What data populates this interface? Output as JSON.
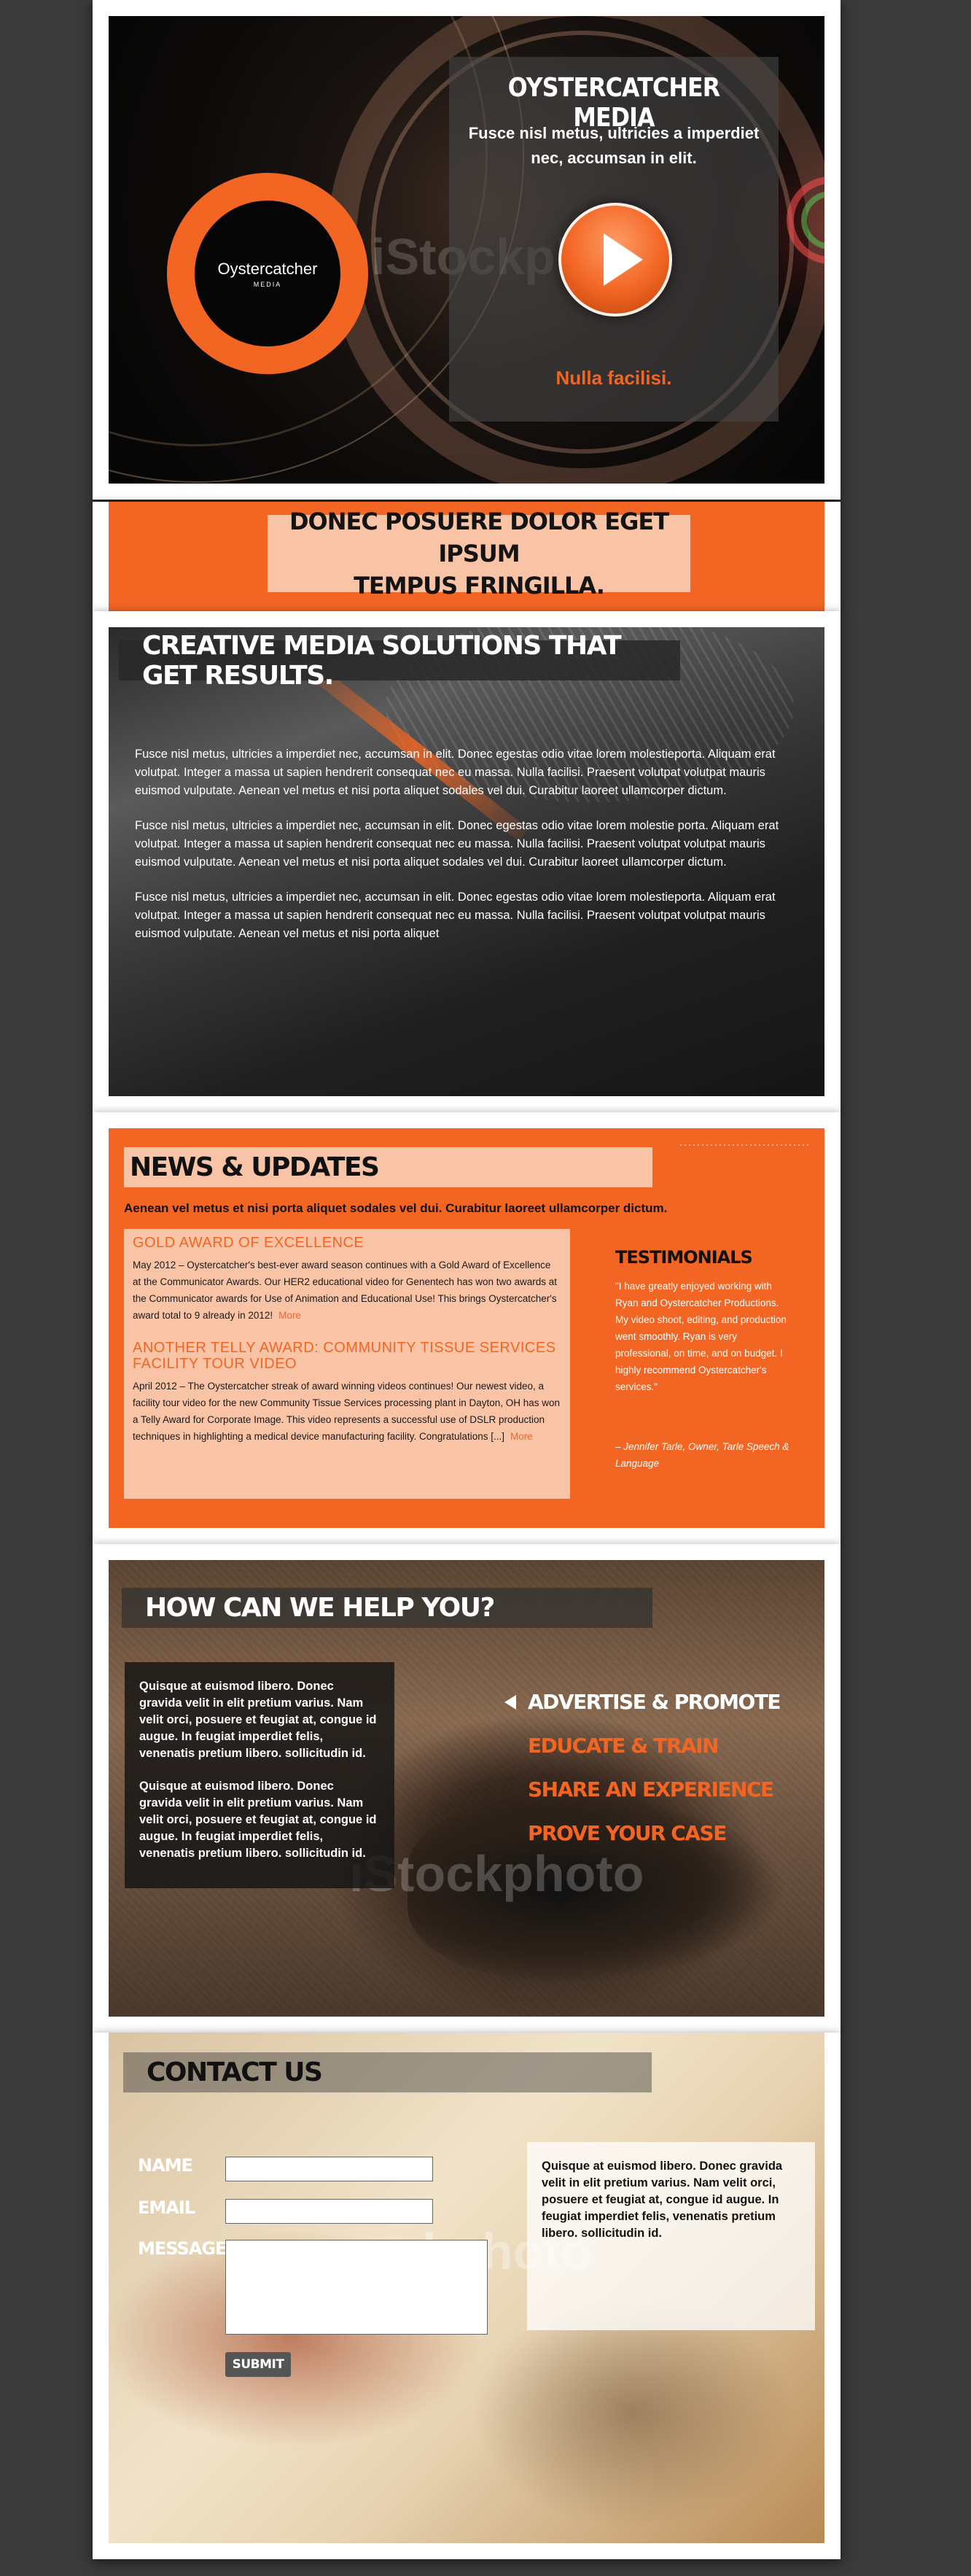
{
  "hero": {
    "logo_name": "Oystercatcher",
    "logo_sub": "MEDIA",
    "watermark": "iStockphoto",
    "title": "OYSTERCATCHER MEDIA",
    "subtitle_line1": "Fusce nisl metus, ultricies a imperdiet",
    "subtitle_line2": "nec, accumsan in elit.",
    "cta": "Nulla facilisi.",
    "accent_color": "#f26522"
  },
  "banner": {
    "line1": "DONEC POSUERE DOLOR EGET IPSUM",
    "line2": "TEMPUS FRINGILLA."
  },
  "creative": {
    "heading": "CREATIVE MEDIA SOLUTIONS THAT GET RESULTS.",
    "paragraphs": [
      "Fusce nisl metus, ultricies a imperdiet nec, accumsan in elit. Donec egestas odio vitae lorem molestieporta. Aliquam erat volutpat. Integer a massa ut sapien hendrerit consequat nec eu massa. Nulla facilisi. Praesent volutpat volutpat mauris euismod vulputate. Aenean vel metus et nisi porta aliquet sodales vel dui. Curabitur laoreet ullamcorper dictum.",
      "Fusce nisl metus, ultricies a imperdiet nec, accumsan in elit. Donec egestas odio vitae lorem molestie porta. Aliquam erat volutpat. Integer a massa ut sapien hendrerit consequat nec eu massa. Nulla facilisi. Praesent volutpat volutpat mauris euismod vulputate. Aenean vel metus et nisi porta aliquet sodales vel dui. Curabitur laoreet ullamcorper dictum.",
      "Fusce nisl metus, ultricies a imperdiet nec, accumsan in elit. Donec egestas odio vitae lorem molestieporta. Aliquam erat volutpat. Integer a massa ut sapien hendrerit consequat nec eu massa. Nulla facilisi. Praesent volutpat volutpat mauris euismod vulputate. Aenean vel metus et nisi porta aliquet"
    ]
  },
  "news": {
    "heading": "NEWS & UPDATES",
    "intro": "Aenean vel metus et nisi porta aliquet sodales vel dui. Curabitur laoreet ullamcorper dictum.",
    "items": [
      {
        "title": "GOLD AWARD OF EXCELLENCE",
        "body": "May 2012 – Oystercatcher's best-ever award season continues with a Gold Award of Excellence at the Communicator Awards.  Our HER2 educational video for Genentech has won two awards at the Communicator awards for Use of Animation and Educational Use!  This brings Oystercatcher's award total to 9 already in 2012!",
        "more": "More"
      },
      {
        "title": "ANOTHER TELLY AWARD: COMMUNITY TISSUE SERVICES FACILITY TOUR VIDEO",
        "body": "April 2012 – The Oystercatcher streak of award winning videos continues!  Our newest video, a facility tour video for the new Community Tissue Services processing plant in Dayton, OH has won a Telly Award for Corporate Image.  This video represents a successful use of DSLR production techniques in highlighting a medical device manufacturing facility.  Congratulations [...]",
        "more": "More"
      }
    ],
    "testimonials_heading": "TESTIMONIALS",
    "testimonial_quote": "\"I have greatly enjoyed working with Ryan and Oystercatcher Productions. My video shoot, editing, and production went smoothly. Ryan is very professional, on time, and on budget. I highly recommend Oystercatcher's services.\"",
    "testimonial_author": "– Jennifer Tarle, Owner, Tarle Speech & Language"
  },
  "help": {
    "heading": "HOW CAN WE HELP YOU?",
    "paragraphs": [
      "Quisque at euismod libero. Donec gravida velit in elit pretium varius. Nam velit orci, posuere et feugiat at, congue id augue. In feugiat imperdiet felis, venenatis pretium libero. sollicitudin id.",
      "Quisque at euismod libero. Donec gravida velit in elit pretium varius. Nam velit orci, posuere et feugiat at, congue id augue. In feugiat imperdiet felis, venenatis pretium libero. sollicitudin id."
    ],
    "menu": [
      "ADVERTISE & PROMOTE",
      "EDUCATE & TRAIN",
      "SHARE AN EXPERIENCE",
      "PROVE YOUR CASE"
    ],
    "watermark": "iStockphoto"
  },
  "contact": {
    "heading": "CONTACT US",
    "name_label": "NAME",
    "email_label": "EMAIL",
    "message_label": "MESSAGE",
    "name_value": "",
    "email_value": "",
    "message_value": "",
    "submit_label": "SUBMIT",
    "note": "Quisque at euismod libero. Donec gravida velit in elit pretium varius. Nam velit orci, posuere et feugiat at, congue id augue. In feugiat imperdiet felis, venenatis pretium libero. sollicitudin id.",
    "watermark": "kphoto"
  }
}
